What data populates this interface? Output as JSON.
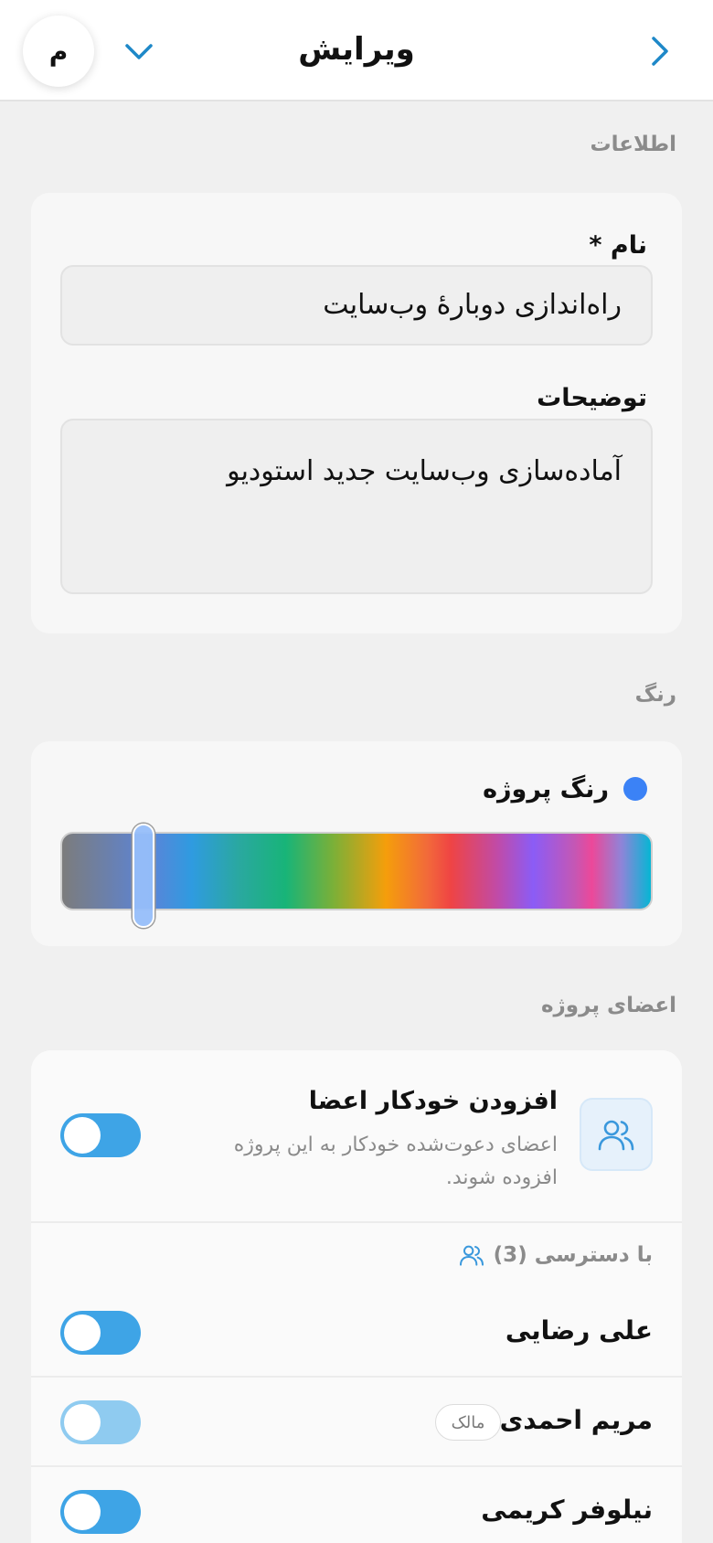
{
  "header": {
    "title": "ویرایش",
    "avatar_letter": "م",
    "back_icon": "chevron-right-icon",
    "menu_icon": "chevron-down-icon",
    "accent_color": "#1e88c8"
  },
  "sections": {
    "info_label": "اطلاعات",
    "color_label": "رنگ",
    "members_label": "اعضای پروژه"
  },
  "form": {
    "name_label": "نام *",
    "name_value": "راه‌اندازی دوبارهٔ وب‌سایت",
    "description_label": "توضیحات",
    "description_value": "آماده‌سازی وب‌سایت جدید استودیو"
  },
  "color": {
    "project_color_label": "رنگ پروژه",
    "selected_color": "#3b82f6",
    "slider_position": 0.14
  },
  "members": {
    "auto_add_title": "افزودن خودکار اعضا",
    "auto_add_description": "اعضای دعوت‌شده خودکار به این پروژه افزوده شوند.",
    "auto_add_enabled": true,
    "access_label": "با دسترسی (3)",
    "list": [
      {
        "name": "علی رضایی",
        "badge": "",
        "enabled": true
      },
      {
        "name": "مریم احمدی",
        "badge": "مالک",
        "enabled": true
      },
      {
        "name": "نیلوفر کریمی",
        "badge": "",
        "enabled": true
      }
    ]
  }
}
